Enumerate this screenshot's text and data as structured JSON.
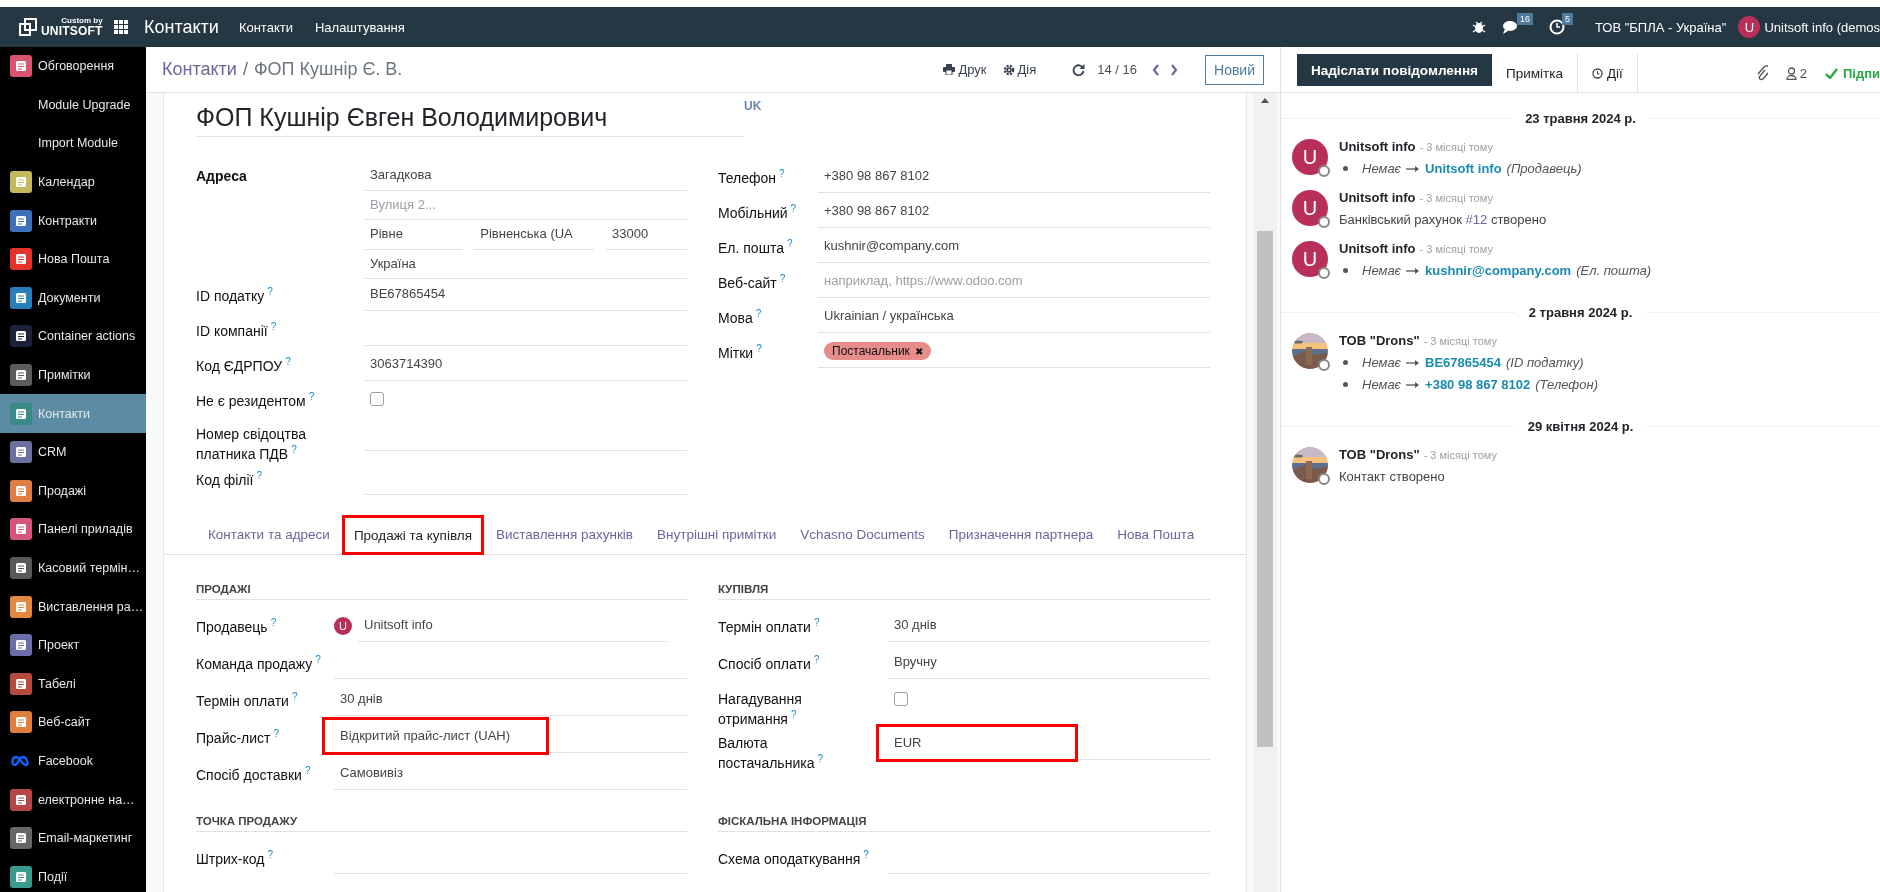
{
  "topbar": {
    "brand_caption": "Custom by",
    "brand_name": "UNITSOFT",
    "app_title": "Контакти",
    "menu": [
      "Контакти",
      "Налаштування"
    ],
    "messages_badge": "16",
    "activities_badge": "5",
    "company": "ТОВ \"БПЛА - Україна\"",
    "user_initial": "U",
    "user_name": "Unitsoft info (demos"
  },
  "sidebar": {
    "items": [
      {
        "label": "Обговорення",
        "kind": "tile",
        "color": "#d9546f",
        "selected": false
      },
      {
        "label": "Module Upgrade",
        "kind": "plain",
        "selected": false
      },
      {
        "label": "Import Module",
        "kind": "plain",
        "selected": false
      },
      {
        "label": "Календар",
        "kind": "tile",
        "color": "#c4b75c",
        "selected": false
      },
      {
        "label": "Контракти",
        "kind": "tile",
        "color": "#3d70b8",
        "selected": false
      },
      {
        "label": "Нова Пошта",
        "kind": "tile",
        "color": "#e5322b",
        "selected": false
      },
      {
        "label": "Документи",
        "kind": "tile",
        "color": "#2a7fba",
        "selected": false
      },
      {
        "label": "Container actions",
        "kind": "tile",
        "color": "#1b2238",
        "selected": false
      },
      {
        "label": "Примітки",
        "kind": "tile",
        "color": "#5c5c5c",
        "selected": false
      },
      {
        "label": "Контакти",
        "kind": "tile",
        "color": "#3a8b86",
        "selected": true
      },
      {
        "label": "CRM",
        "kind": "tile",
        "color": "#6a70a0",
        "selected": false
      },
      {
        "label": "Продажі",
        "kind": "tile",
        "color": "#e07c46",
        "selected": false
      },
      {
        "label": "Панелі приладів",
        "kind": "tile",
        "color": "#d4567c",
        "selected": false
      },
      {
        "label": "Касовий термін…",
        "kind": "tile",
        "color": "#585858",
        "selected": false
      },
      {
        "label": "Виставлення ра…",
        "kind": "tile",
        "color": "#e28840",
        "selected": false
      },
      {
        "label": "Проект",
        "kind": "tile",
        "color": "#6b6fa8",
        "selected": false
      },
      {
        "label": "Табелі",
        "kind": "tile",
        "color": "#b44a3c",
        "selected": false
      },
      {
        "label": "Веб-сайт",
        "kind": "tile",
        "color": "#e07e3d",
        "selected": false
      },
      {
        "label": "Facebook",
        "kind": "logo",
        "color": "#0866ff",
        "selected": false
      },
      {
        "label": "електронне на…",
        "kind": "tile",
        "color": "#b54646",
        "selected": false
      },
      {
        "label": "Email-маркетинг",
        "kind": "tile",
        "color": "#666666",
        "selected": false
      },
      {
        "label": "Події",
        "kind": "tile",
        "color": "#3a9a8e",
        "selected": false
      }
    ]
  },
  "control_panel": {
    "breadcrumb": [
      {
        "label": "Контакти",
        "kind": "link"
      },
      {
        "label": "/",
        "kind": "separator"
      },
      {
        "label": "ФОП Кушнір Є. В.",
        "kind": "current"
      }
    ],
    "actions": [
      {
        "label": "Друк",
        "kind": "print"
      },
      {
        "label": "Дія",
        "kind": "gear"
      }
    ],
    "pager": "14 / 16",
    "new_button": "Новий"
  },
  "form": {
    "name": "ФОП Кушнір Євген Володимирович",
    "language": "UK",
    "left_fields": [
      {
        "label": "Адреса",
        "kind": "address",
        "lines": [
          [
            {
              "value": "Загадкова"
            }
          ],
          [
            {
              "placeholder": "Вулиця 2..."
            }
          ],
          [
            {
              "value": "Рівне"
            },
            {
              "value": "Рівненська (UA"
            },
            {
              "value": "33000"
            }
          ],
          [
            {
              "value": "Україна"
            }
          ]
        ]
      },
      {
        "label": "ID податку",
        "help": "?",
        "kind": "text",
        "value": "BE67865454"
      },
      {
        "label": "ID компанії",
        "help": "?",
        "kind": "text"
      },
      {
        "label": "Код ЄДРПОУ",
        "help": "?",
        "kind": "text",
        "value": "3063714390"
      },
      {
        "label": "Не є резидентом",
        "help": "?",
        "kind": "checkbox",
        "checked": false
      },
      {
        "label": "Номер свідоцтва платника ПДВ",
        "help": "?",
        "kind": "text"
      },
      {
        "label": "Код філії",
        "help": "?",
        "kind": "text"
      }
    ],
    "right_fields": [
      {
        "label": "Телефон",
        "help": "?",
        "kind": "text",
        "value": "+380 98 867 8102"
      },
      {
        "label": "Мобільний",
        "help": "?",
        "kind": "text",
        "value": "+380 98 867 8102"
      },
      {
        "label": "Ел. пошта",
        "help": "?",
        "kind": "text",
        "value": "kushnir@company.com"
      },
      {
        "label": "Веб-сайт",
        "help": "?",
        "kind": "text",
        "placeholder": "наприклад, https://www.odoo.com"
      },
      {
        "label": "Мова",
        "help": "?",
        "kind": "text",
        "value": "Ukrainian / українська"
      },
      {
        "label": "Мітки",
        "help": "?",
        "kind": "tags",
        "tags": [
          {
            "label": "Постачальник",
            "remove": "✖",
            "color": "#e88b8b"
          }
        ]
      }
    ],
    "tabs": [
      {
        "label": "Контакти та адреси",
        "selected": false,
        "highlighted": false
      },
      {
        "label": "Продажі та купівля",
        "selected": true,
        "highlighted": true
      },
      {
        "label": "Виставлення рахунків",
        "selected": false,
        "highlighted": false
      },
      {
        "label": "Внутрішні примітки",
        "selected": false,
        "highlighted": false
      },
      {
        "label": "Vchasno Documents",
        "selected": false,
        "highlighted": false
      },
      {
        "label": "Призначення партнера",
        "selected": false,
        "highlighted": false
      },
      {
        "label": "Нова Пошта",
        "selected": false,
        "highlighted": false
      }
    ],
    "sections": [
      {
        "title": "ПРОДАЖІ",
        "fields": [
          {
            "label": "Продавець",
            "help": "?",
            "kind": "user",
            "avatar": "U",
            "value": "Unitsoft info"
          },
          {
            "label": "Команда продажу",
            "help": "?",
            "kind": "text"
          },
          {
            "label": "Термін оплати",
            "help": "?",
            "kind": "text",
            "value": "30 днів"
          },
          {
            "label": "Прайс-лист",
            "help": "?",
            "kind": "text",
            "value": "Відкритий прайс-лист (UAH)",
            "highlighted": true
          },
          {
            "label": "Спосіб доставки",
            "help": "?",
            "kind": "text",
            "value": "Самовивіз"
          }
        ]
      },
      {
        "title": "КУПІВЛЯ",
        "fields": [
          {
            "label": "Термін оплати",
            "help": "?",
            "kind": "text",
            "value": "30 днів"
          },
          {
            "label": "Спосіб оплати",
            "help": "?",
            "kind": "text",
            "value": "Вручну"
          },
          {
            "label": "Нагадування отримання",
            "help": "?",
            "kind": "checkbox",
            "checked": false
          },
          {
            "label": "Валюта\nпостачальника",
            "help": "?",
            "kind": "text",
            "value": "EUR",
            "highlighted": true
          }
        ]
      },
      {
        "title": "ТОЧКА ПРОДАЖУ",
        "fields": [
          {
            "label": "Штрих-код",
            "help": "?",
            "kind": "text"
          }
        ]
      },
      {
        "title": "ФІСКАЛЬНА ІНФОРМАЦІЯ",
        "fields": [
          {
            "label": "Схема оподаткування",
            "help": "?",
            "kind": "text"
          }
        ]
      }
    ]
  },
  "chatter": {
    "buttons": [
      {
        "label": "Надіслати повідомлення",
        "kind": "send",
        "selected": true
      },
      {
        "label": "Примітка",
        "kind": "note",
        "selected": false
      },
      {
        "label": "Дії",
        "kind": "activity",
        "selected": false
      }
    ],
    "followers": "2",
    "follow": "Підпи",
    "days": [
      {
        "date": "23 травня 2024 р.",
        "messages": [
          {
            "author": "Unitsoft info",
            "time": "- 3 місяці тому",
            "avatar": {
              "kind": "initial",
              "initial": "U"
            },
            "body": {
              "kind": "changes",
              "changes": [
                {
                  "old": "Немає",
                  "new": "Unitsoft info",
                  "field": "(Продавець)"
                }
              ]
            }
          },
          {
            "author": "Unitsoft info",
            "time": "- 3 місяці тому",
            "avatar": {
              "kind": "initial",
              "initial": "U"
            },
            "body": {
              "kind": "text",
              "segments": [
                {
                  "text": "Банківський рахунок",
                  "link": false
                },
                {
                  "text": "#12",
                  "link": true
                },
                {
                  "text": "створено",
                  "link": false
                }
              ]
            }
          },
          {
            "author": "Unitsoft info",
            "time": "- 3 місяці тому",
            "avatar": {
              "kind": "initial",
              "initial": "U"
            },
            "body": {
              "kind": "changes",
              "changes": [
                {
                  "old": "Немає",
                  "new": "kushnir@company.com",
                  "field": "(Ел. пошта)"
                }
              ]
            }
          }
        ]
      },
      {
        "date": "2 травня 2024 р.",
        "messages": [
          {
            "author": "ТОВ \"Drons\"",
            "time": "- 3 місяці тому",
            "body": {
              "kind": "changes",
              "changes": [
                {
                  "old": "Немає",
                  "new": "BE67865454",
                  "field": "(ID податку)"
                },
                {
                  "old": "Немає",
                  "new": "+380 98 867 8102",
                  "field": "(Телефон)"
                }
              ]
            }
          }
        ]
      },
      {
        "date": "29 квітня 2024 р.",
        "messages": [
          {
            "author": "ТОВ \"Drons\"",
            "time": "- 3 місяці тому",
            "body": {
              "kind": "text",
              "segments": [
                {
                  "text": "Контакт створено",
                  "link": false
                }
              ]
            }
          }
        ]
      }
    ]
  }
}
